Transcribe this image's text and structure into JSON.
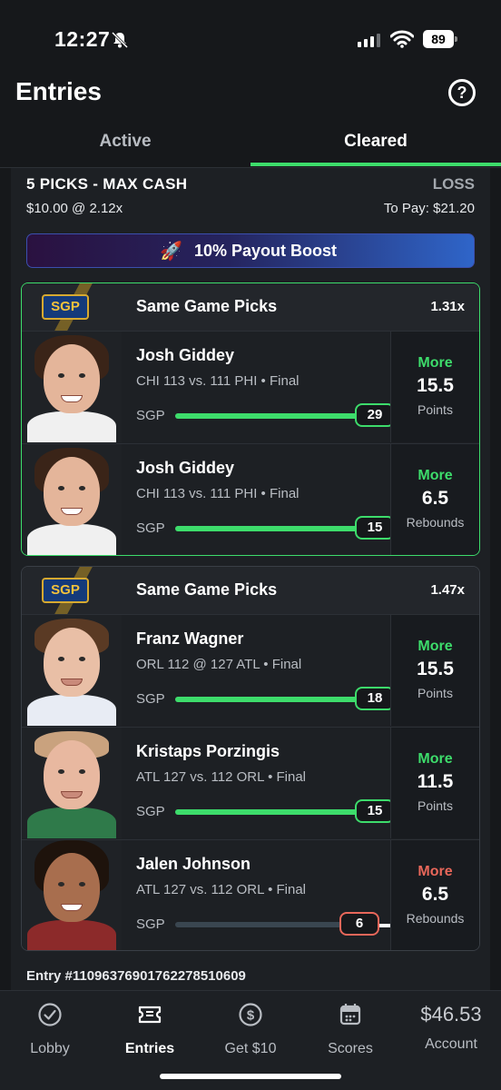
{
  "status_bar": {
    "time": "12:27",
    "battery": "89"
  },
  "header": {
    "title": "Entries",
    "help_label": "?"
  },
  "tabs": [
    {
      "label": "Active"
    },
    {
      "label": "Cleared"
    }
  ],
  "entry": {
    "title": "5 PICKS - MAX CASH",
    "result": "LOSS",
    "stake": "$10.00 @ 2.12x",
    "to_pay": "To Pay: $21.20",
    "boost": {
      "icon": "rocket-icon",
      "text": "10% Payout Boost"
    },
    "entry_id": "Entry #110963769017622785106​09"
  },
  "groups": [
    {
      "badge": "SGP",
      "title": "Same Game Picks",
      "multiplier": "1.31x",
      "picks": [
        {
          "name": "Josh Giddey",
          "game": "CHI 113 vs. 111 PHI • Final",
          "tag": "SGP",
          "actual": "29",
          "actual_value": 29,
          "line_value": 15.5,
          "direction": "More",
          "line": "15.5",
          "stat": "Points",
          "hit": true
        },
        {
          "name": "Josh Giddey",
          "game": "CHI 113 vs. 111 PHI • Final",
          "tag": "SGP",
          "actual": "15",
          "actual_value": 15,
          "line_value": 6.5,
          "direction": "More",
          "line": "6.5",
          "stat": "Rebounds",
          "hit": true
        }
      ]
    },
    {
      "badge": "SGP",
      "title": "Same Game Picks",
      "multiplier": "1.47x",
      "picks": [
        {
          "name": "Franz Wagner",
          "game": "ORL 112 @ 127 ATL • Final",
          "tag": "SGP",
          "actual": "18",
          "actual_value": 18,
          "line_value": 15.5,
          "direction": "More",
          "line": "15.5",
          "stat": "Points",
          "hit": true
        },
        {
          "name": "Kristaps Porzingis",
          "game": "ATL 127 vs. 112 ORL • Final",
          "tag": "SGP",
          "actual": "15",
          "actual_value": 15,
          "line_value": 11.5,
          "direction": "More",
          "line": "11.5",
          "stat": "Points",
          "hit": true
        },
        {
          "name": "Jalen Johnson",
          "game": "ATL 127 vs. 112 ORL • Final",
          "tag": "SGP",
          "actual": "6",
          "actual_value": 6,
          "line_value": 6.5,
          "direction": "More",
          "line": "6.5",
          "stat": "Rebounds",
          "hit": false
        }
      ]
    }
  ],
  "nav": [
    {
      "label": "Lobby",
      "icon": "check-circle-icon"
    },
    {
      "label": "Entries",
      "icon": "ticket-icon",
      "active": true
    },
    {
      "label": "Get $10",
      "icon": "dollar-circle-icon"
    },
    {
      "label": "Scores",
      "icon": "calendar-icon"
    },
    {
      "label": "Account",
      "balance": "$46.53"
    }
  ],
  "colors": {
    "accent": "#3ddc6b",
    "miss": "#e8675a",
    "sgp_gold": "#f3c23b",
    "background": "#16181b"
  }
}
